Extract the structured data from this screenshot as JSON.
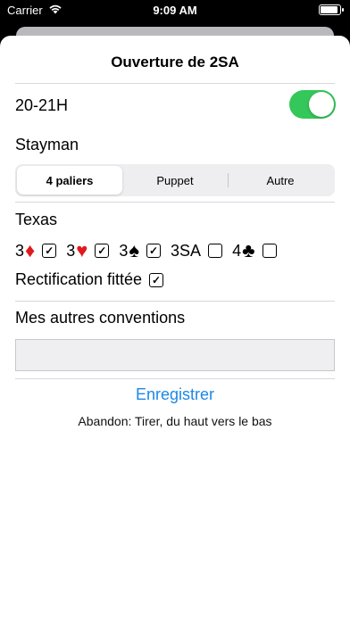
{
  "status_bar": {
    "carrier": "Carrier",
    "time": "9:09 AM",
    "wifi_icon": "wifi-icon",
    "battery_icon": "battery-icon"
  },
  "sheet": {
    "title": "Ouverture de 2SA"
  },
  "range_row": {
    "label": "20-21H",
    "toggle_on": true,
    "toggle_color": "#34c759"
  },
  "stayman": {
    "label": "Stayman",
    "options": [
      "4 paliers",
      "Puppet",
      "Autre"
    ],
    "selected": "4 paliers"
  },
  "texas": {
    "label": "Texas",
    "items": [
      {
        "level": "3",
        "suit": "♦",
        "suit_name": "diamond-icon",
        "checked": true
      },
      {
        "level": "3",
        "suit": "♥",
        "suit_name": "heart-icon",
        "checked": true
      },
      {
        "level": "3",
        "suit": "♠",
        "suit_name": "spade-icon",
        "checked": true
      },
      {
        "level": "3SA",
        "suit": "",
        "suit_name": "",
        "checked": false
      },
      {
        "level": "4",
        "suit": "♣",
        "suit_name": "club-icon",
        "checked": false
      }
    ]
  },
  "rectification": {
    "label": "Rectification fittée",
    "checked": true
  },
  "other_conventions": {
    "label": "Mes autres conventions",
    "value": "",
    "placeholder": ""
  },
  "actions": {
    "save_label": "Enregistrer",
    "hint": "Abandon: Tirer, du haut vers le bas"
  },
  "colors": {
    "accent": "#1e88e5",
    "toggle_on": "#34c759",
    "suit_red": "#e0191f"
  }
}
